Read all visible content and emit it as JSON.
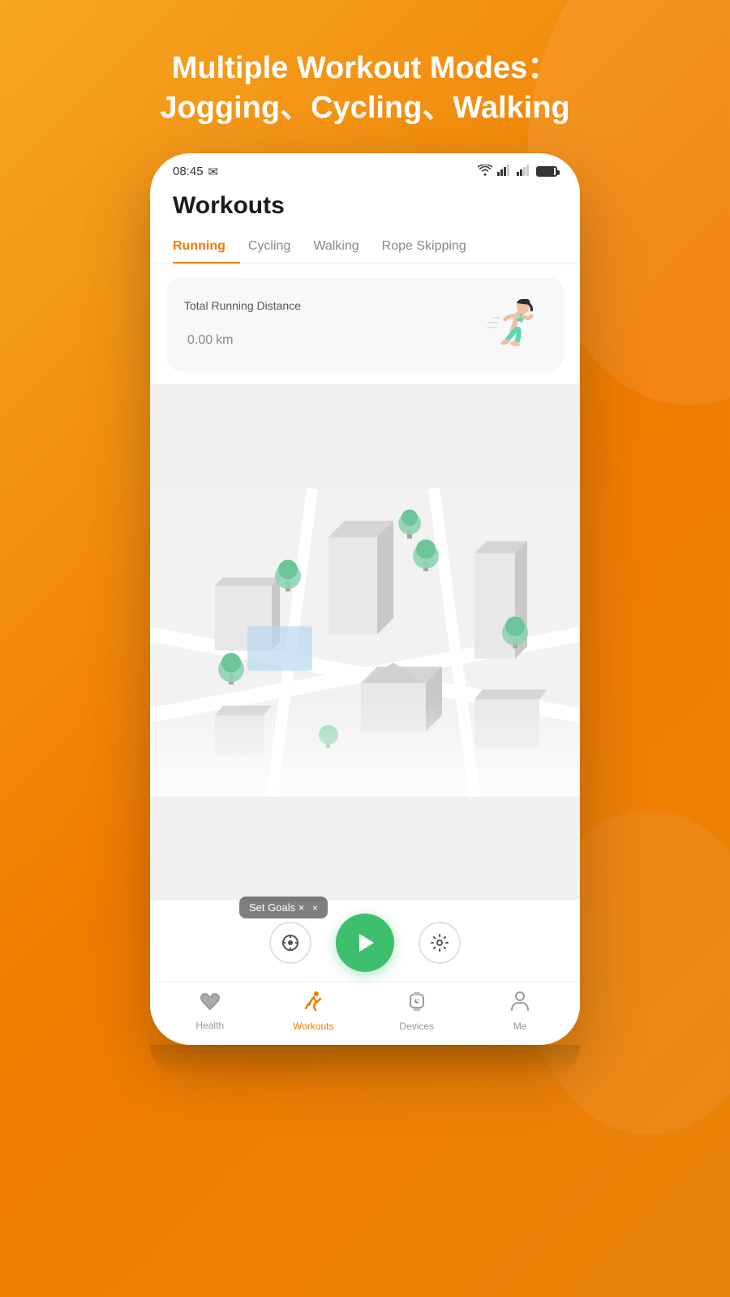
{
  "background": {
    "gradient_start": "#f5a623",
    "gradient_end": "#e8830a"
  },
  "header": {
    "line1": "Multiple Workout Modes：",
    "line2": "Jogging、Cycling、Walking"
  },
  "status_bar": {
    "time": "08:45",
    "wifi": true,
    "signal1": "atl",
    "signal2": "atl"
  },
  "app": {
    "title": "Workouts"
  },
  "tabs": [
    {
      "label": "Running",
      "active": true
    },
    {
      "label": "Cycling",
      "active": false
    },
    {
      "label": "Walking",
      "active": false
    },
    {
      "label": "Rope Skipping",
      "active": false
    }
  ],
  "stats_card": {
    "label": "Total Running Distance",
    "value": "0.00",
    "unit": "km"
  },
  "controls": {
    "set_goals_label": "Set Goals",
    "play_label": "Start",
    "location_label": "Location",
    "settings_label": "Settings"
  },
  "bottom_nav": {
    "items": [
      {
        "label": "Health",
        "icon": "heart",
        "active": false
      },
      {
        "label": "Workouts",
        "icon": "run",
        "active": true
      },
      {
        "label": "Devices",
        "icon": "watch",
        "active": false
      },
      {
        "label": "Me",
        "icon": "person",
        "active": false
      }
    ]
  }
}
